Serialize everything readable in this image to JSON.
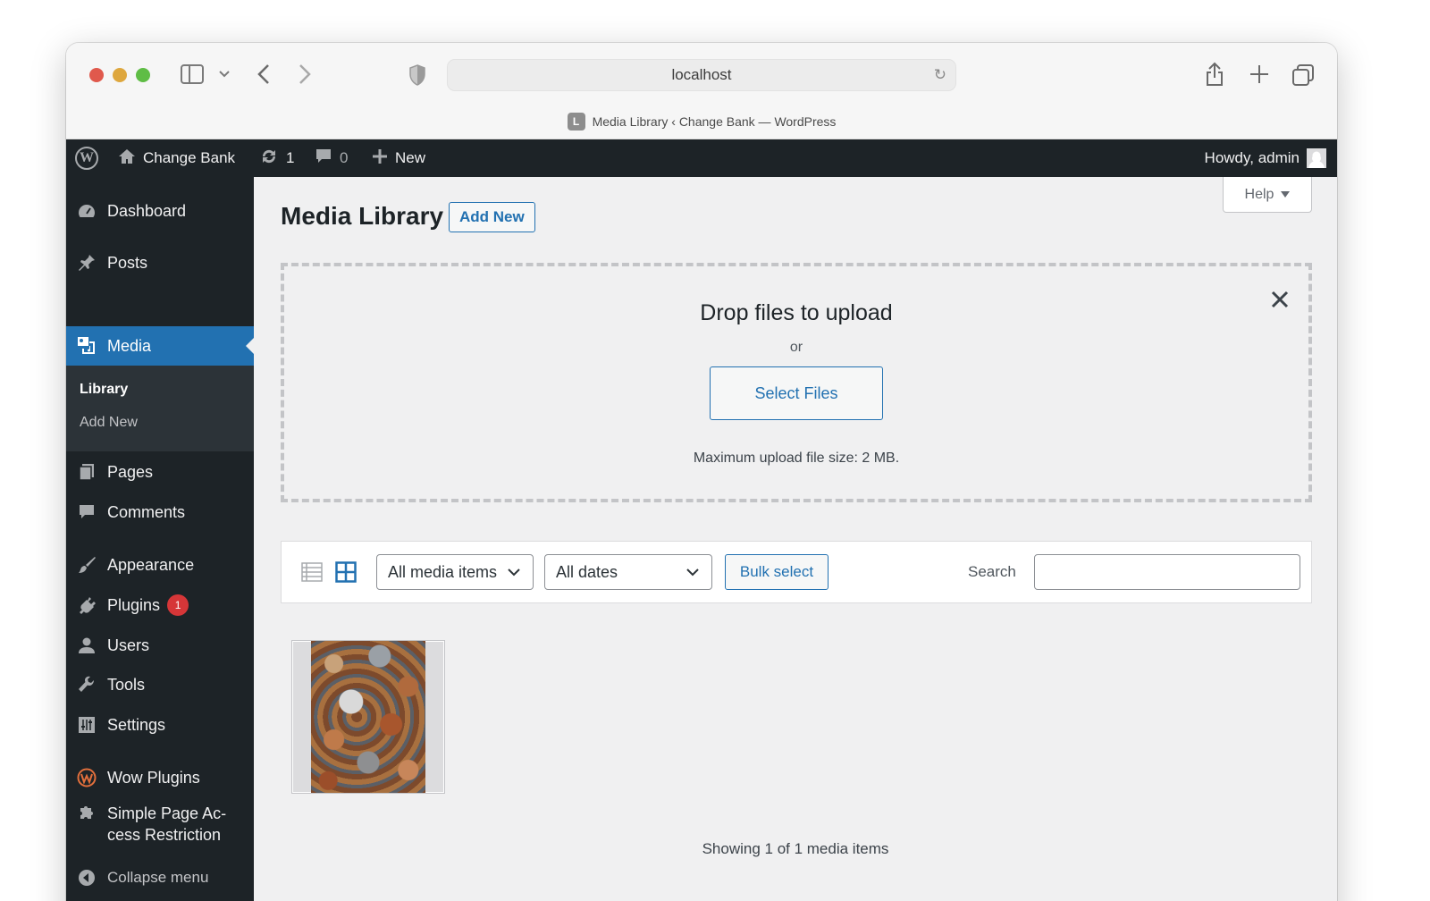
{
  "browser": {
    "url": "localhost",
    "tab_title": "Media Library ‹ Change Bank — WordPress",
    "favicon_letter": "L"
  },
  "adminbar": {
    "site_name": "Change Bank",
    "updates_count": "1",
    "comments_count": "0",
    "new_label": "New",
    "howdy": "Howdy, admin"
  },
  "menu": {
    "dashboard": "Dashboard",
    "posts": "Posts",
    "media": "Media",
    "library": "Library",
    "add_new": "Add New",
    "pages": "Pages",
    "comments": "Comments",
    "appearance": "Appearance",
    "plugins": "Plugins",
    "plugins_badge": "1",
    "users": "Users",
    "tools": "Tools",
    "settings": "Settings",
    "wow_plugins": "Wow Plugins",
    "simple_page_line1": "Simple Page Ac-",
    "simple_page_line2": "cess Restriction",
    "collapse": "Collapse menu"
  },
  "page": {
    "title": "Media Library",
    "add_new": "Add New",
    "help": "Help"
  },
  "dropzone": {
    "title": "Drop files to upload",
    "or": "or",
    "select_files": "Select Files",
    "max_size": "Maximum upload file size: 2 MB."
  },
  "toolbar": {
    "filter_type": "All media items",
    "filter_date": "All dates",
    "bulk_select": "Bulk select",
    "search_label": "Search",
    "search_value": ""
  },
  "results": {
    "count_text": "Showing 1 of 1 media items"
  },
  "colors": {
    "admin_dark": "#1d2327",
    "accent_blue": "#2271b1",
    "badge_red": "#d63638"
  }
}
